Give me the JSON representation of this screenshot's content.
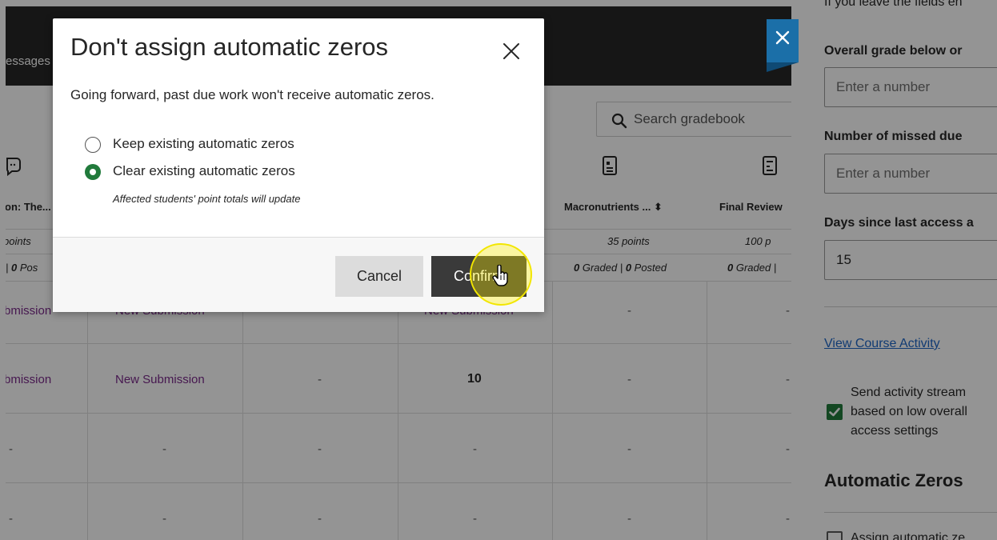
{
  "gradebook": {
    "nav_tab": "essages",
    "search_placeholder": "Search gradebook",
    "columns": [
      {
        "header": "on: The...",
        "points": "points",
        "graded_prefix": "| ",
        "graded_count": "0",
        "graded_suffix": " Pos"
      },
      {
        "header": "Macronutrients ... ⬍",
        "points": "35 points",
        "graded_count": "0",
        "graded_mid": " Graded | ",
        "posted_count": "0",
        "posted_suffix": " Posted"
      },
      {
        "header": "Final Review",
        "points": "100 p",
        "graded_count": "0",
        "graded_mid": " Graded |"
      }
    ],
    "rows": [
      [
        "bmission",
        "New Submission",
        "",
        "New Submission",
        "-",
        "-"
      ],
      [
        "bmission",
        "New Submission",
        "-",
        "10",
        "-",
        "-"
      ],
      [
        "-",
        "-",
        "-",
        "-",
        "-",
        "-"
      ],
      [
        "-",
        "-",
        "-",
        "-",
        "-",
        "-"
      ]
    ]
  },
  "panel": {
    "intro_text": "If you leave the fields en",
    "grade_label": "Overall grade below or",
    "grade_placeholder": "Enter a number",
    "missed_label": "Number of missed due",
    "missed_placeholder": "Enter a number",
    "days_label": "Days since last access a",
    "days_value": "15",
    "view_activity_link": "View Course Activity",
    "activity_checkbox_lines": [
      "Send activity stream",
      "based on low overall",
      "access settings"
    ],
    "automatic_zeros_heading": "Automatic Zeros",
    "assign_zeros_label": "Assign automatic ze"
  },
  "modal": {
    "title": "Don't assign automatic zeros",
    "description": "Going forward, past due work won't receive automatic zeros.",
    "options": [
      {
        "label": "Keep existing automatic zeros",
        "selected": false
      },
      {
        "label": "Clear existing automatic zeros",
        "selected": true
      }
    ],
    "helper_text": "Affected students' point totals will update",
    "cancel_label": "Cancel",
    "confirm_label": "Confirm"
  },
  "colors": {
    "accent_green": "#217a3b",
    "link_blue": "#1e66c7",
    "submission_purple": "#7a2a8a",
    "close_tab_blue": "#1b6fa8"
  }
}
